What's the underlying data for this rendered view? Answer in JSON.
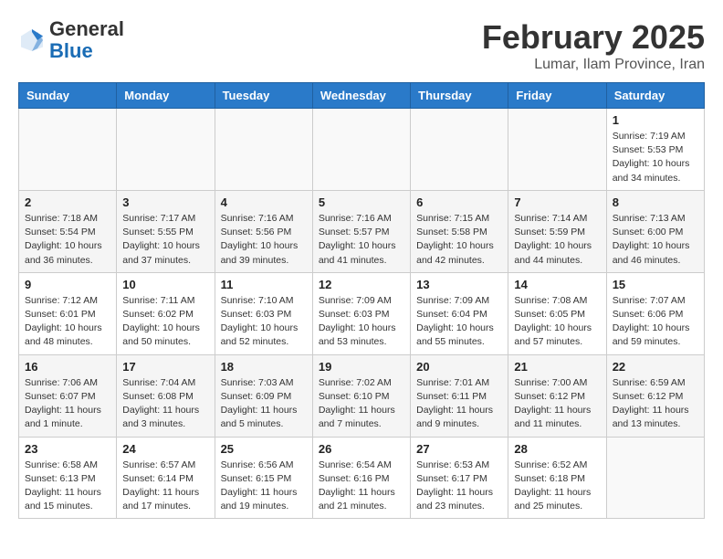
{
  "header": {
    "logo_general": "General",
    "logo_blue": "Blue",
    "month_year": "February 2025",
    "location": "Lumar, Ilam Province, Iran"
  },
  "days_of_week": [
    "Sunday",
    "Monday",
    "Tuesday",
    "Wednesday",
    "Thursday",
    "Friday",
    "Saturday"
  ],
  "weeks": [
    {
      "alt": false,
      "days": [
        {
          "num": "",
          "detail": ""
        },
        {
          "num": "",
          "detail": ""
        },
        {
          "num": "",
          "detail": ""
        },
        {
          "num": "",
          "detail": ""
        },
        {
          "num": "",
          "detail": ""
        },
        {
          "num": "",
          "detail": ""
        },
        {
          "num": "1",
          "detail": "Sunrise: 7:19 AM\nSunset: 5:53 PM\nDaylight: 10 hours\nand 34 minutes."
        }
      ]
    },
    {
      "alt": true,
      "days": [
        {
          "num": "2",
          "detail": "Sunrise: 7:18 AM\nSunset: 5:54 PM\nDaylight: 10 hours\nand 36 minutes."
        },
        {
          "num": "3",
          "detail": "Sunrise: 7:17 AM\nSunset: 5:55 PM\nDaylight: 10 hours\nand 37 minutes."
        },
        {
          "num": "4",
          "detail": "Sunrise: 7:16 AM\nSunset: 5:56 PM\nDaylight: 10 hours\nand 39 minutes."
        },
        {
          "num": "5",
          "detail": "Sunrise: 7:16 AM\nSunset: 5:57 PM\nDaylight: 10 hours\nand 41 minutes."
        },
        {
          "num": "6",
          "detail": "Sunrise: 7:15 AM\nSunset: 5:58 PM\nDaylight: 10 hours\nand 42 minutes."
        },
        {
          "num": "7",
          "detail": "Sunrise: 7:14 AM\nSunset: 5:59 PM\nDaylight: 10 hours\nand 44 minutes."
        },
        {
          "num": "8",
          "detail": "Sunrise: 7:13 AM\nSunset: 6:00 PM\nDaylight: 10 hours\nand 46 minutes."
        }
      ]
    },
    {
      "alt": false,
      "days": [
        {
          "num": "9",
          "detail": "Sunrise: 7:12 AM\nSunset: 6:01 PM\nDaylight: 10 hours\nand 48 minutes."
        },
        {
          "num": "10",
          "detail": "Sunrise: 7:11 AM\nSunset: 6:02 PM\nDaylight: 10 hours\nand 50 minutes."
        },
        {
          "num": "11",
          "detail": "Sunrise: 7:10 AM\nSunset: 6:03 PM\nDaylight: 10 hours\nand 52 minutes."
        },
        {
          "num": "12",
          "detail": "Sunrise: 7:09 AM\nSunset: 6:03 PM\nDaylight: 10 hours\nand 53 minutes."
        },
        {
          "num": "13",
          "detail": "Sunrise: 7:09 AM\nSunset: 6:04 PM\nDaylight: 10 hours\nand 55 minutes."
        },
        {
          "num": "14",
          "detail": "Sunrise: 7:08 AM\nSunset: 6:05 PM\nDaylight: 10 hours\nand 57 minutes."
        },
        {
          "num": "15",
          "detail": "Sunrise: 7:07 AM\nSunset: 6:06 PM\nDaylight: 10 hours\nand 59 minutes."
        }
      ]
    },
    {
      "alt": true,
      "days": [
        {
          "num": "16",
          "detail": "Sunrise: 7:06 AM\nSunset: 6:07 PM\nDaylight: 11 hours\nand 1 minute."
        },
        {
          "num": "17",
          "detail": "Sunrise: 7:04 AM\nSunset: 6:08 PM\nDaylight: 11 hours\nand 3 minutes."
        },
        {
          "num": "18",
          "detail": "Sunrise: 7:03 AM\nSunset: 6:09 PM\nDaylight: 11 hours\nand 5 minutes."
        },
        {
          "num": "19",
          "detail": "Sunrise: 7:02 AM\nSunset: 6:10 PM\nDaylight: 11 hours\nand 7 minutes."
        },
        {
          "num": "20",
          "detail": "Sunrise: 7:01 AM\nSunset: 6:11 PM\nDaylight: 11 hours\nand 9 minutes."
        },
        {
          "num": "21",
          "detail": "Sunrise: 7:00 AM\nSunset: 6:12 PM\nDaylight: 11 hours\nand 11 minutes."
        },
        {
          "num": "22",
          "detail": "Sunrise: 6:59 AM\nSunset: 6:12 PM\nDaylight: 11 hours\nand 13 minutes."
        }
      ]
    },
    {
      "alt": false,
      "days": [
        {
          "num": "23",
          "detail": "Sunrise: 6:58 AM\nSunset: 6:13 PM\nDaylight: 11 hours\nand 15 minutes."
        },
        {
          "num": "24",
          "detail": "Sunrise: 6:57 AM\nSunset: 6:14 PM\nDaylight: 11 hours\nand 17 minutes."
        },
        {
          "num": "25",
          "detail": "Sunrise: 6:56 AM\nSunset: 6:15 PM\nDaylight: 11 hours\nand 19 minutes."
        },
        {
          "num": "26",
          "detail": "Sunrise: 6:54 AM\nSunset: 6:16 PM\nDaylight: 11 hours\nand 21 minutes."
        },
        {
          "num": "27",
          "detail": "Sunrise: 6:53 AM\nSunset: 6:17 PM\nDaylight: 11 hours\nand 23 minutes."
        },
        {
          "num": "28",
          "detail": "Sunrise: 6:52 AM\nSunset: 6:18 PM\nDaylight: 11 hours\nand 25 minutes."
        },
        {
          "num": "",
          "detail": ""
        }
      ]
    }
  ]
}
